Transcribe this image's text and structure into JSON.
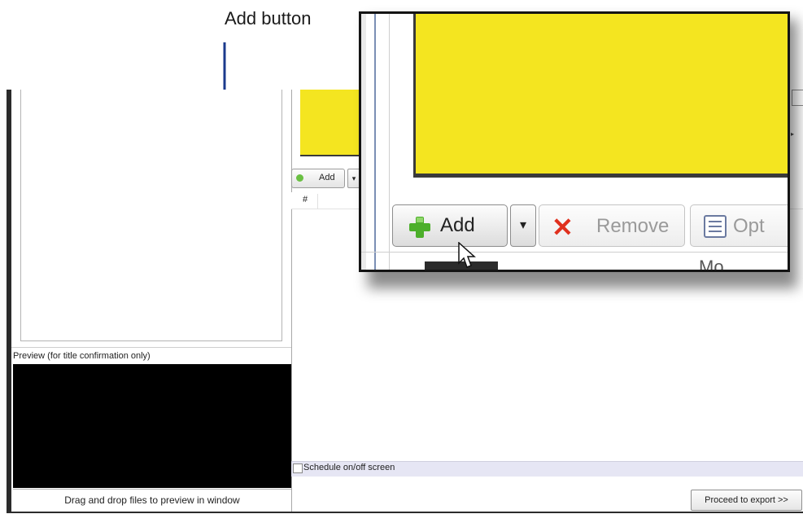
{
  "callout": {
    "label": "Add button"
  },
  "left_panel": {
    "preview_label": "Preview (for title confirmation only)",
    "drag_hint": "Drag and drop files to preview in window"
  },
  "toolbar": {
    "add_label": "Add",
    "dropdown_glyph": "▾"
  },
  "list": {
    "columns": [
      "#"
    ]
  },
  "schedule": {
    "label": "Schedule on/off screen",
    "checked": false
  },
  "footer": {
    "proceed_label": "Proceed to export >>"
  },
  "zoom": {
    "add_label": "Add",
    "dropdown_glyph": "▾",
    "remove_label": "Remove",
    "options_label": "Opt",
    "partial_text": "Mo"
  },
  "colors": {
    "yellow": "#f4e520",
    "callout_line": "#1b3a8c",
    "add_plus": "#4caf2a",
    "remove_x": "#e0301e"
  },
  "icons": [
    "plus-icon",
    "close-icon",
    "options-list-icon",
    "mouse-cursor-icon",
    "chevron-down-icon"
  ]
}
